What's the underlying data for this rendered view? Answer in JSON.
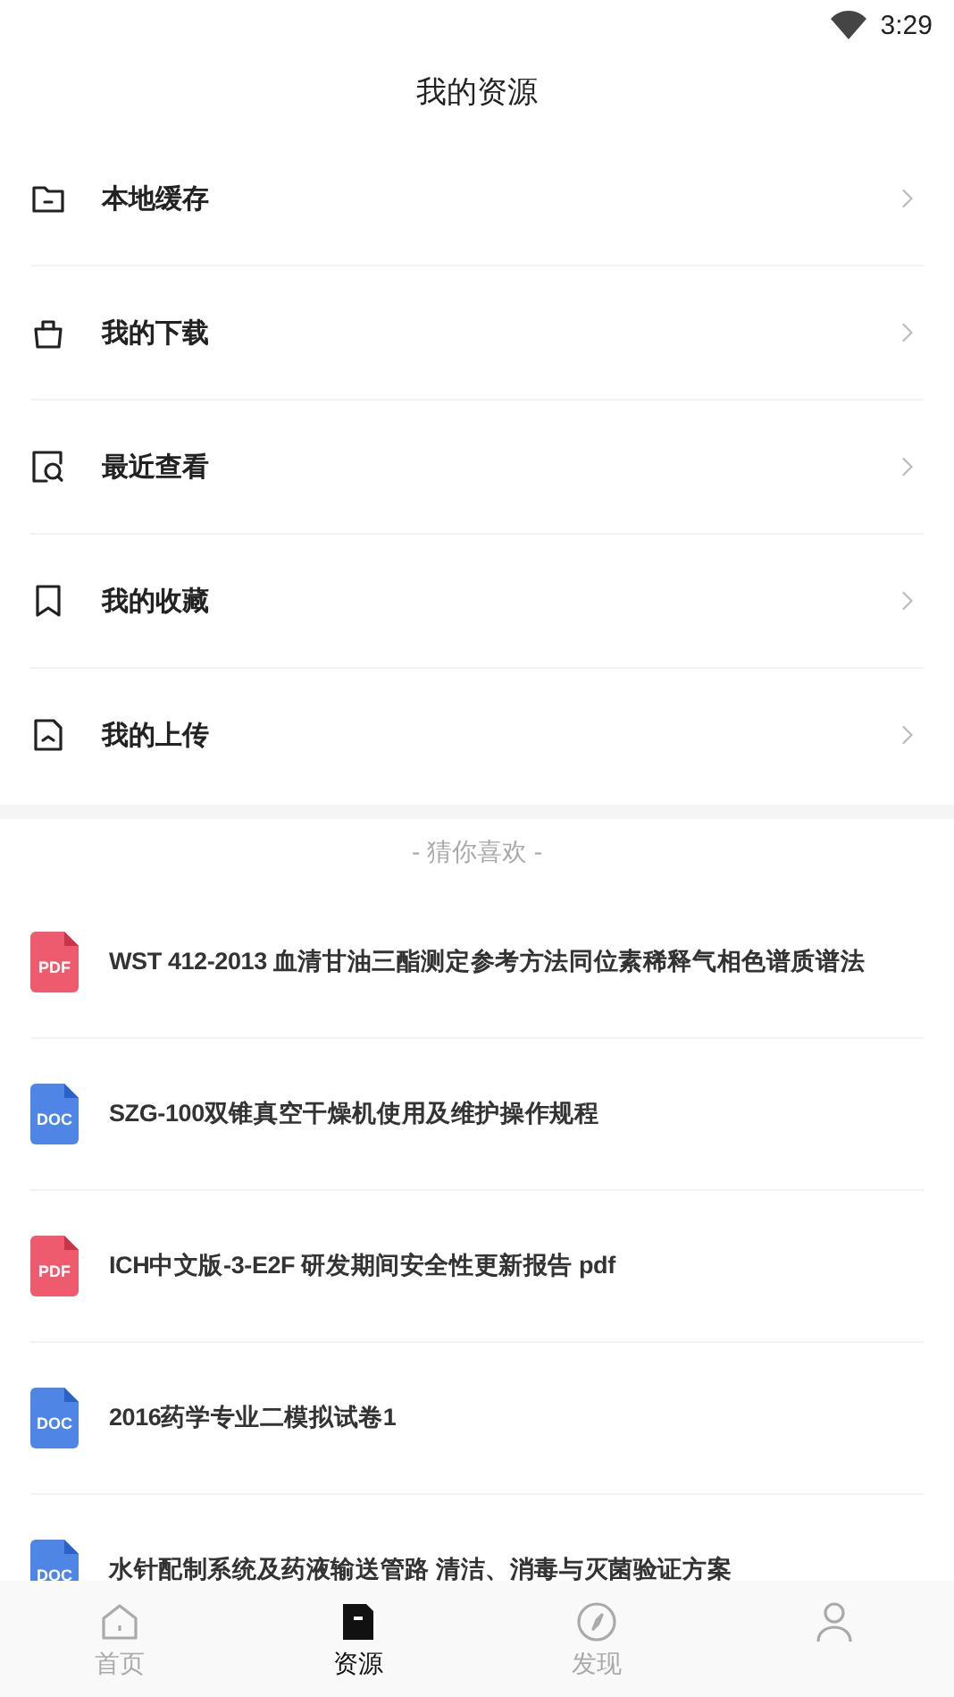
{
  "status_bar": {
    "time": "3:29"
  },
  "header": {
    "title": "我的资源"
  },
  "menu": [
    {
      "kind": "folder",
      "label": "本地缓存"
    },
    {
      "kind": "bag",
      "label": "我的下载"
    },
    {
      "kind": "recent",
      "label": "最近查看"
    },
    {
      "kind": "bookmark",
      "label": "我的收藏"
    },
    {
      "kind": "upload",
      "label": "我的上传"
    }
  ],
  "recommend": {
    "heading": "- 猜你喜欢 -",
    "items": [
      {
        "kind": "pdf",
        "badge": "PDF",
        "title": "WST 412-2013 血清甘油三酯测定参考方法同位素稀释气相色谱质谱法"
      },
      {
        "kind": "doc",
        "badge": "DOC",
        "title": "SZG-100双锥真空干燥机使用及维护操作规程"
      },
      {
        "kind": "pdf",
        "badge": "PDF",
        "title": "ICH中文版-3-E2F 研发期间安全性更新报告 pdf"
      },
      {
        "kind": "doc",
        "badge": "DOC",
        "title": "2016药学专业二模拟试卷1"
      },
      {
        "kind": "doc",
        "badge": "DOC",
        "title": "水针配制系统及药液输送管路 清洁、消毒与灭菌验证方案"
      }
    ]
  },
  "tab_bar": [
    {
      "kind": "home",
      "label": "首页",
      "selected": false
    },
    {
      "kind": "resource",
      "label": "资源",
      "selected": true
    },
    {
      "kind": "discover",
      "label": "发现",
      "selected": false
    },
    {
      "kind": "me",
      "selected": false
    }
  ]
}
